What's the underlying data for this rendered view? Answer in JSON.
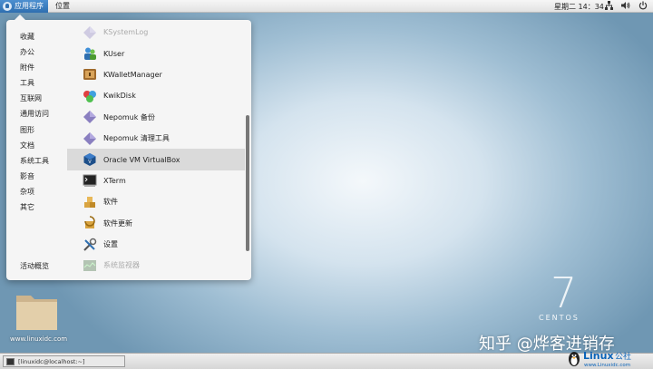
{
  "topbar": {
    "apps_label": "应用程序",
    "places_label": "位置",
    "clock": "星期二 14：34"
  },
  "menu": {
    "categories": [
      "收藏",
      "办公",
      "附件",
      "工具",
      "互联网",
      "通用访问",
      "图形",
      "文档",
      "系统工具",
      "影音",
      "杂项",
      "其它"
    ],
    "overview_label": "活动概览",
    "apps": [
      {
        "label": "KSystemLog",
        "icon": "diamond-icon"
      },
      {
        "label": "KUser",
        "icon": "users-icon"
      },
      {
        "label": "KWalletManager",
        "icon": "wallet-icon"
      },
      {
        "label": "KwikDisk",
        "icon": "disk-icon"
      },
      {
        "label": "Nepomuk 备份",
        "icon": "diamond-icon"
      },
      {
        "label": "Nepomuk 清理工具",
        "icon": "diamond-icon"
      },
      {
        "label": "Oracle VM VirtualBox",
        "icon": "virtualbox-icon"
      },
      {
        "label": "XTerm",
        "icon": "terminal-icon"
      },
      {
        "label": "软件",
        "icon": "package-icon"
      },
      {
        "label": "软件更新",
        "icon": "update-icon"
      },
      {
        "label": "设置",
        "icon": "tools-icon"
      },
      {
        "label": "系统监视器",
        "icon": "monitor-icon"
      }
    ]
  },
  "desktop": {
    "folder_label": "www.linuxidc.com",
    "centos_seven": "7",
    "centos_text": "CENTOS",
    "watermark": "知乎 @烨客进销存"
  },
  "taskbar": {
    "task_label": "[linuxidc@localhost:~]"
  },
  "logo": {
    "text": "Linux公社",
    "subtext": "www.Linuxidc.com"
  },
  "colors": {
    "accent": "#2f6fb0",
    "menu_bg": "#f5f5f5",
    "selected_bg": "#dadada"
  }
}
